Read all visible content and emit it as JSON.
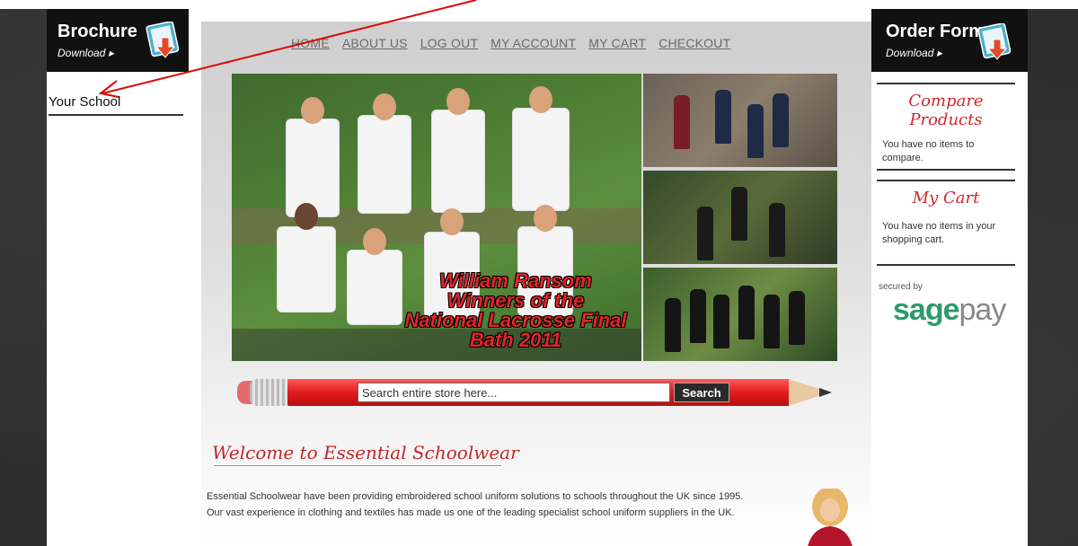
{
  "left": {
    "brochure_title": "Brochure",
    "brochure_sub": "Download ▸",
    "your_school": "Your School"
  },
  "nav": {
    "items": [
      "HOME",
      "ABOUT US",
      "LOG OUT",
      "MY ACCOUNT",
      "MY CART",
      "CHECKOUT"
    ]
  },
  "hero": {
    "caption": [
      "William Ransom",
      "Winners of the",
      "National Lacrosse Final",
      "Bath 2011"
    ]
  },
  "search": {
    "placeholder": "Search entire store here...",
    "button": "Search"
  },
  "welcome": {
    "title": "Welcome to Essential Schoolwear",
    "body": "Essential Schoolwear have been providing embroidered school uniform solutions to schools throughout the UK since 1995. Our vast experience in clothing and textiles has made us one of the leading specialist  school uniform suppliers in the UK."
  },
  "right": {
    "orderform_title": "Order Form",
    "orderform_sub": "Download ▸",
    "compare_title": "Compare Products",
    "compare_text": "You have no items to compare.",
    "cart_title": "My Cart",
    "cart_text": "You have no items in your shopping cart.",
    "secured_by": "secured by",
    "sagepay_brand": "sage",
    "sagepay_brand2": "pay"
  },
  "colors": {
    "accent_red": "#d3262b",
    "sagepay_green": "#2f9b6a",
    "annotation_arrow": "#e00000"
  }
}
